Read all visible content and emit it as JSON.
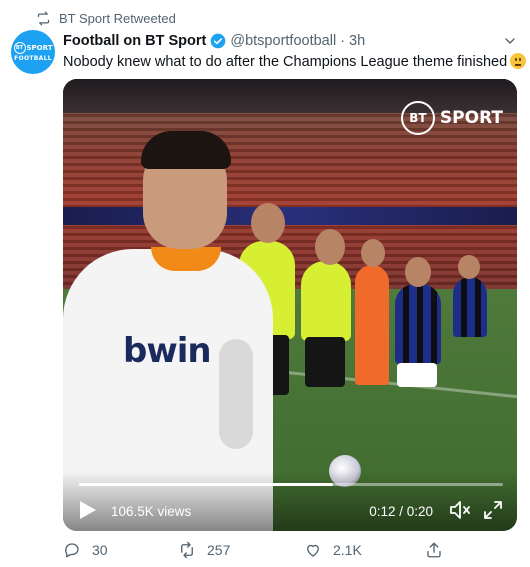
{
  "retweet_label": "BT Sport Retweeted",
  "avatar": {
    "line1": "SPORT",
    "badge": "BT",
    "line2": "FOOTBALL"
  },
  "tweet": {
    "author_name": "Football on BT Sport",
    "handle": "@btsportfootball",
    "separator": "·",
    "time": "3h",
    "text": "Nobody knew what to do after the Champions League theme finished",
    "emoji": "neutral-face"
  },
  "video": {
    "overlay_logo": {
      "badge": "BT",
      "text": "SPORT"
    },
    "sponsor_text": "bwin",
    "views": "106.5K views",
    "timecode": "0:12 / 0:20",
    "progress": 0.6
  },
  "actions": {
    "replies": "30",
    "retweets": "257",
    "likes": "2.1K"
  },
  "colors": {
    "accent": "#1da1f2",
    "secondary_text": "#536471",
    "primary_text": "#0f1419",
    "referee_kit": "#d6ef33",
    "valencia_collar": "#f28a17"
  }
}
